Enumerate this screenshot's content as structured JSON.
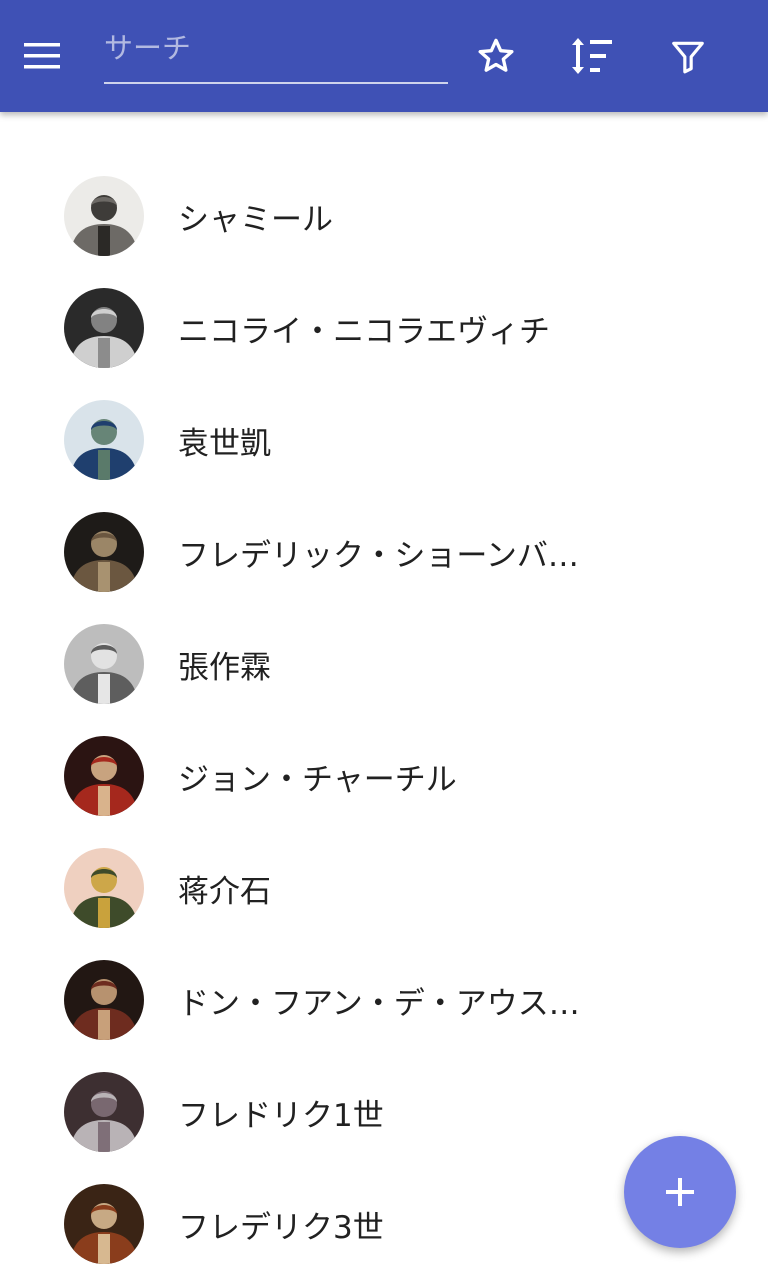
{
  "toolbar": {
    "search_placeholder": "サーチ",
    "menu_icon": "menu-icon",
    "favorite_icon": "star-outline-icon",
    "sort_icon": "sort-icon",
    "filter_icon": "filter-icon",
    "bar_color": "#3f51b5"
  },
  "people": [
    {
      "name": "シャミール",
      "avatar_bg": "#ecebe8",
      "avatar_fg": "#6d6a66",
      "avatar_accent": "#2b2926"
    },
    {
      "name": "ニコライ・ニコラエヴィチ",
      "avatar_bg": "#2a2a2a",
      "avatar_fg": "#cfcfcf",
      "avatar_accent": "#8c8c8c"
    },
    {
      "name": "袁世凱",
      "avatar_bg": "#d9e3ea",
      "avatar_fg": "#1f3f6e",
      "avatar_accent": "#5a7a6a"
    },
    {
      "name": "フレデリック・ショーンバーグ",
      "avatar_bg": "#1e1b18",
      "avatar_fg": "#6b5740",
      "avatar_accent": "#a89270"
    },
    {
      "name": "張作霖",
      "avatar_bg": "#bdbdbd",
      "avatar_fg": "#5e5e5e",
      "avatar_accent": "#e6e6e6"
    },
    {
      "name": "ジョン・チャーチル",
      "avatar_bg": "#2b1412",
      "avatar_fg": "#a5281d",
      "avatar_accent": "#d9b38c"
    },
    {
      "name": "蒋介石",
      "avatar_bg": "#efd0c0",
      "avatar_fg": "#3e4b2a",
      "avatar_accent": "#c9a23c"
    },
    {
      "name": "ドン・フアン・デ・アウストリア",
      "avatar_bg": "#221713",
      "avatar_fg": "#6e2c1f",
      "avatar_accent": "#c8a07a"
    },
    {
      "name": "フレドリク1世",
      "avatar_bg": "#3d2f31",
      "avatar_fg": "#b9b3b6",
      "avatar_accent": "#7f6f78"
    },
    {
      "name": "フレデリク3世",
      "avatar_bg": "#3a2415",
      "avatar_fg": "#8a3d1c",
      "avatar_accent": "#d7b890"
    }
  ],
  "fab": {
    "icon": "plus-icon",
    "color": "#7480e5"
  }
}
